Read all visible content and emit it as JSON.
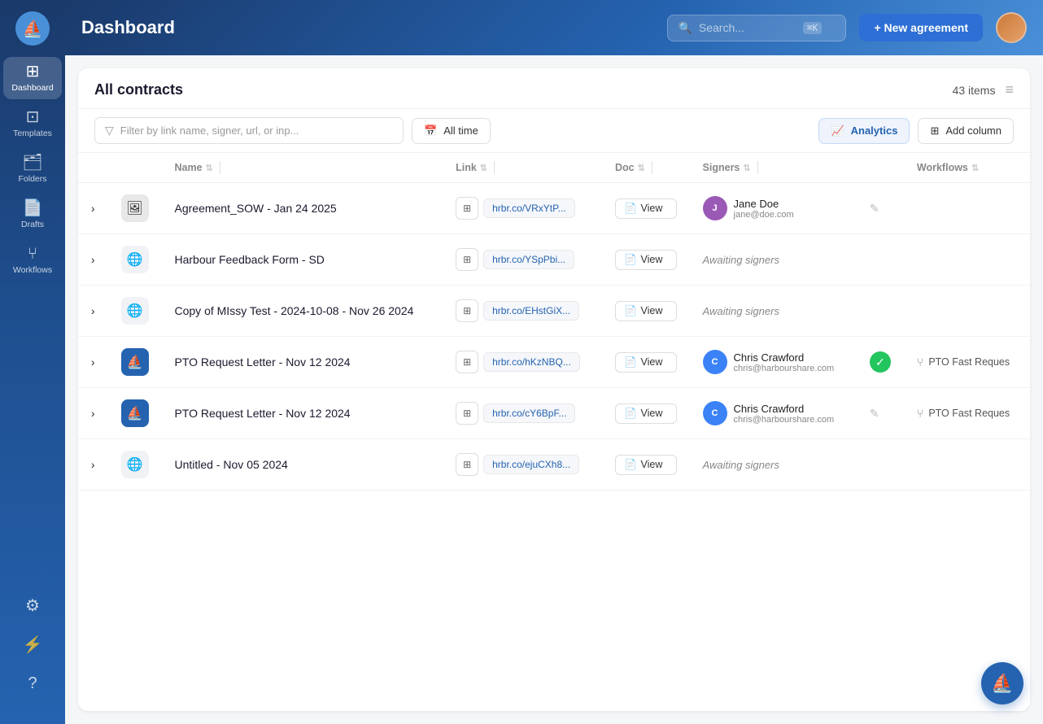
{
  "app": {
    "title": "Dashboard"
  },
  "topbar": {
    "title": "Dashboard",
    "search_placeholder": "Search...",
    "search_shortcut": "⌘K",
    "new_agreement_label": "+ New agreement"
  },
  "sidebar": {
    "items": [
      {
        "id": "dashboard",
        "label": "Dashboard",
        "icon": "⊞",
        "active": true
      },
      {
        "id": "templates",
        "label": "Templates",
        "icon": "⊡",
        "active": false
      },
      {
        "id": "folders",
        "label": "Folders",
        "icon": "🗂",
        "active": false
      },
      {
        "id": "drafts",
        "label": "Drafts",
        "icon": "📄",
        "active": false
      },
      {
        "id": "workflows",
        "label": "Workflows",
        "icon": "⑂",
        "active": false
      }
    ],
    "bottom_items": [
      {
        "id": "settings",
        "icon": "⚙",
        "label": "Settings"
      },
      {
        "id": "flash",
        "icon": "⚡",
        "label": "Flash"
      },
      {
        "id": "help",
        "icon": "?",
        "label": "Help"
      }
    ]
  },
  "panel": {
    "title": "All contracts",
    "items_count": "43 items",
    "filter_placeholder": "Filter by link name, signer, url, or inp...",
    "date_filter_label": "All time",
    "analytics_label": "Analytics",
    "add_column_label": "Add column"
  },
  "table": {
    "columns": [
      {
        "id": "name",
        "label": "Name"
      },
      {
        "id": "link",
        "label": "Link"
      },
      {
        "id": "doc",
        "label": "Doc"
      },
      {
        "id": "signers",
        "label": "Signers"
      },
      {
        "id": "workflows",
        "label": "Workflows"
      }
    ],
    "rows": [
      {
        "id": 1,
        "name": "Agreement_SOW - Jan 24 2025",
        "icon_type": "image",
        "link_url": "hrbr.co/VRxYtP...",
        "signer_name": "Jane Doe",
        "signer_email": "jane@doe.com",
        "signer_avatar_color": "#9b59b6",
        "signer_initials": "J",
        "status": "edit",
        "workflow": null
      },
      {
        "id": 2,
        "name": "Harbour Feedback Form - SD",
        "icon_type": "globe",
        "link_url": "hrbr.co/YSpPbi...",
        "signer_name": null,
        "signer_status": "Awaiting signers",
        "status": null,
        "workflow": null
      },
      {
        "id": 3,
        "name": "Copy of MIssy Test - 2024-10-08 - Nov 26 2024",
        "icon_type": "globe",
        "link_url": "hrbr.co/EHstGiX...",
        "signer_name": null,
        "signer_status": "Awaiting signers",
        "status": null,
        "workflow": null
      },
      {
        "id": 4,
        "name": "PTO Request Letter - Nov 12 2024",
        "icon_type": "brand",
        "link_url": "hrbr.co/hKzNBQ...",
        "signer_name": "Chris Crawford",
        "signer_email": "chris@harbourshare.com",
        "signer_avatar_color": "#3b82f6",
        "signer_initials": "C",
        "status": "check",
        "workflow": "PTO Fast Reques"
      },
      {
        "id": 5,
        "name": "PTO Request Letter - Nov 12 2024",
        "icon_type": "brand",
        "link_url": "hrbr.co/cY6BpF...",
        "signer_name": "Chris Crawford",
        "signer_email": "chris@harbourshare.com",
        "signer_avatar_color": "#3b82f6",
        "signer_initials": "C",
        "status": "edit",
        "workflow": "PTO Fast Reques"
      },
      {
        "id": 6,
        "name": "Untitled - Nov 05 2024",
        "icon_type": "globe",
        "link_url": "hrbr.co/ejuCXh8...",
        "signer_name": null,
        "signer_status": "Awaiting signers",
        "status": null,
        "workflow": null
      }
    ]
  },
  "icons": {
    "search": "🔍",
    "calendar": "📅",
    "analytics": "📈",
    "add_column": "⊞",
    "chevron_right": "›",
    "qr": "⊞",
    "doc": "📄",
    "globe": "🌐",
    "workflow": "⑂",
    "check": "✓",
    "edit": "✎",
    "harbor_logo": "⛵"
  }
}
